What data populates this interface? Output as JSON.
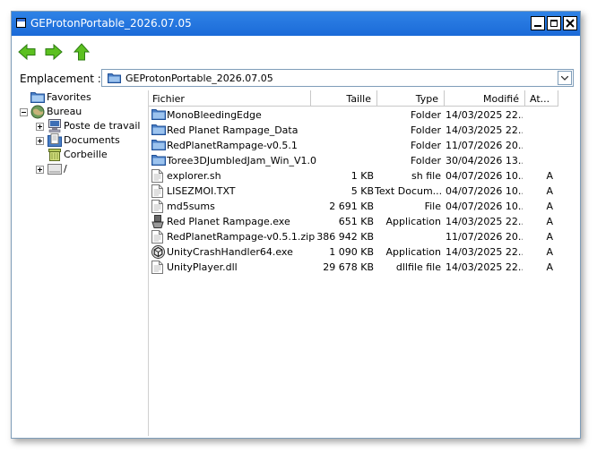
{
  "window": {
    "title": "GEProtonPortable_2026.07.05"
  },
  "location": {
    "label": "Emplacement :",
    "value": "GEProtonPortable_2026.07.05"
  },
  "tree": [
    {
      "label": "Favorites",
      "icon": "favorites-folder-icon",
      "expander": "none"
    },
    {
      "label": "Bureau",
      "icon": "desktop-globe-icon",
      "expander": "minus"
    },
    {
      "label": "Poste de travail",
      "icon": "computer-icon",
      "expander": "plus"
    },
    {
      "label": "Documents",
      "icon": "documents-icon",
      "expander": "plus"
    },
    {
      "label": "Corbeille",
      "icon": "trash-icon",
      "expander": "none"
    },
    {
      "label": "/",
      "icon": "drive-icon",
      "expander": "plus"
    }
  ],
  "columns": {
    "name": "Fichier",
    "size": "Taille",
    "type": "Type",
    "modified": "Modifié",
    "attributes": "At..."
  },
  "files": [
    {
      "name": "MonoBleedingEdge",
      "size": "",
      "type": "Folder",
      "modified": "14/03/2025 22...",
      "attr": "",
      "icon": "folder"
    },
    {
      "name": "Red Planet Rampage_Data",
      "size": "",
      "type": "Folder",
      "modified": "14/03/2025 22...",
      "attr": "",
      "icon": "folder"
    },
    {
      "name": "RedPlanetRampage-v0.5.1",
      "size": "",
      "type": "Folder",
      "modified": "11/07/2026 20...",
      "attr": "",
      "icon": "folder"
    },
    {
      "name": "Toree3DJumbledJam_Win_V1.0",
      "size": "",
      "type": "Folder",
      "modified": "30/04/2026 13...",
      "attr": "",
      "icon": "folder"
    },
    {
      "name": "explorer.sh",
      "size": "1 KB",
      "type": "sh file",
      "modified": "04/07/2026 10...",
      "attr": "A",
      "icon": "file"
    },
    {
      "name": "LISEZMOI.TXT",
      "size": "5 KB",
      "type": "Text Docum...",
      "modified": "04/07/2026 10...",
      "attr": "A",
      "icon": "file"
    },
    {
      "name": "md5sums",
      "size": "2 691 KB",
      "type": "File",
      "modified": "04/07/2026 10...",
      "attr": "A",
      "icon": "file"
    },
    {
      "name": "Red Planet Rampage.exe",
      "size": "651 KB",
      "type": "Application",
      "modified": "14/03/2025 22...",
      "attr": "A",
      "icon": "exe"
    },
    {
      "name": "RedPlanetRampage-v0.5.1.zip",
      "size": "386 942 KB",
      "type": "",
      "modified": "11/07/2026 20...",
      "attr": "A",
      "icon": "file"
    },
    {
      "name": "UnityCrashHandler64.exe",
      "size": "1 090 KB",
      "type": "Application",
      "modified": "14/03/2025 22...",
      "attr": "A",
      "icon": "unity"
    },
    {
      "name": "UnityPlayer.dll",
      "size": "29 678 KB",
      "type": "dllfile file",
      "modified": "14/03/2025 22...",
      "attr": "A",
      "icon": "file"
    }
  ],
  "colors": {
    "titlebar": "#1b6ad8",
    "folder": "#4a7fc6",
    "arrow": "#4caf1f"
  }
}
